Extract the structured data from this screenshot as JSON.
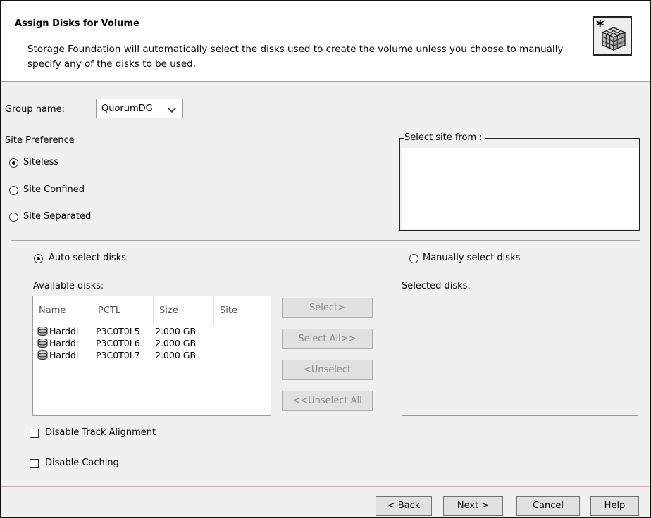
{
  "header": {
    "title": "Assign Disks for Volume",
    "description": "Storage Foundation will automatically select the disks used to create the volume unless you choose to manually specify any of the disks to be used.",
    "icon": "rubik-cube-wizard-icon"
  },
  "group": {
    "label": "Group name:",
    "value": "QuorumDG"
  },
  "site_preference": {
    "label": "Site Preference",
    "options": [
      {
        "label": "Siteless",
        "selected": true
      },
      {
        "label": "Site Confined",
        "selected": false
      },
      {
        "label": "Site Separated",
        "selected": false
      }
    ]
  },
  "select_site": {
    "label": "Select site from :"
  },
  "selection_mode": {
    "auto_label": "Auto select disks",
    "auto_selected": true,
    "manual_label": "Manually select disks",
    "manual_selected": false
  },
  "available": {
    "label": "Available disks:",
    "columns": [
      "Name",
      "PCTL",
      "Size",
      "Site"
    ],
    "rows": [
      {
        "name": "Harddi",
        "pctl": "P3C0T0L5",
        "size": "2.000 GB",
        "site": ""
      },
      {
        "name": "Harddi",
        "pctl": "P3C0T0L6",
        "size": "2.000 GB",
        "site": ""
      },
      {
        "name": "Harddi",
        "pctl": "P3C0T0L7",
        "size": "2.000 GB",
        "site": ""
      }
    ]
  },
  "selected": {
    "label": "Selected disks:"
  },
  "transfer_buttons": {
    "select": "Select>",
    "select_all": "Select All>>",
    "unselect": "<Unselect",
    "unselect_all": "<<Unselect All"
  },
  "options": {
    "disable_track_alignment": "Disable Track Alignment",
    "disable_caching": "Disable Caching"
  },
  "footer": {
    "back": "< Back",
    "next": "Next >",
    "cancel": "Cancel",
    "help": "Help"
  },
  "colors": {
    "window_bg": "#f0f0f0",
    "button_bg": "#e1e1e1",
    "disabled_text": "#8a8a8a"
  }
}
